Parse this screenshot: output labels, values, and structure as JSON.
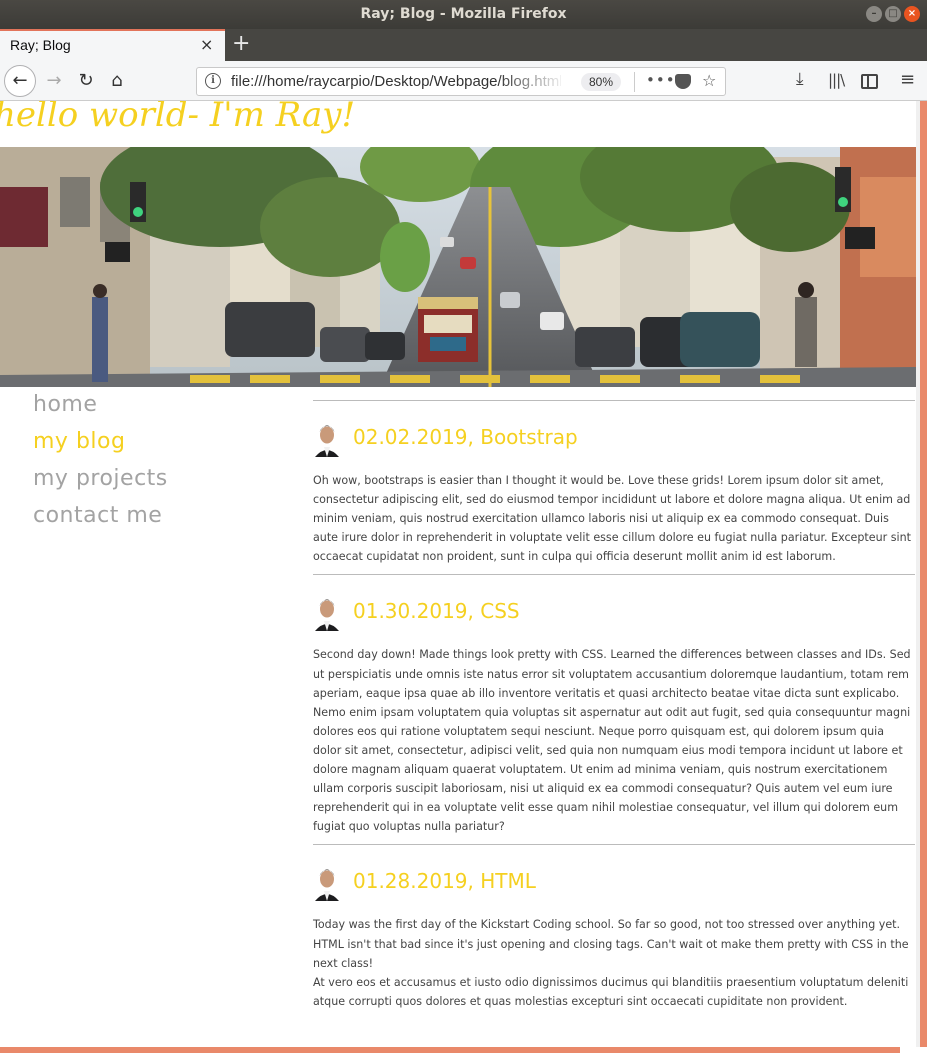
{
  "window": {
    "title": "Ray; Blog - Mozilla Firefox",
    "minimize_glyph": "–",
    "maximize_glyph": "□",
    "close_glyph": "×"
  },
  "tab": {
    "title": "Ray; Blog",
    "close_glyph": "×",
    "newtab_glyph": "+"
  },
  "navbar": {
    "back_glyph": "←",
    "forward_glyph": "→",
    "reload_glyph": "↻",
    "home_glyph": "⌂",
    "url": "file:///home/raycarpio/Desktop/Webpage/blog.html",
    "info_glyph": "i",
    "zoom": "80%",
    "more_glyph": "•••",
    "star_glyph": "☆",
    "download_glyph": "⤓",
    "library_glyph": "|||\\",
    "menu_glyph": "≡"
  },
  "page": {
    "site_title": "hello world- I'm Ray!",
    "nav": [
      {
        "label": "home",
        "active": false
      },
      {
        "label": "my blog",
        "active": true
      },
      {
        "label": "my projects",
        "active": false
      },
      {
        "label": "contact me",
        "active": false
      }
    ],
    "posts": [
      {
        "title": "02.02.2019, Bootstrap",
        "paragraphs": [
          "Oh wow, bootstraps is easier than I thought it would be. Love these grids! Lorem ipsum dolor sit amet, consectetur adipiscing elit, sed do eiusmod tempor incididunt ut labore et dolore magna aliqua. Ut enim ad minim veniam, quis nostrud exercitation ullamco laboris nisi ut aliquip ex ea commodo consequat. Duis aute irure dolor in reprehenderit in voluptate velit esse cillum dolore eu fugiat nulla pariatur. Excepteur sint occaecat cupidatat non proident, sunt in culpa qui officia deserunt mollit anim id est laborum."
        ]
      },
      {
        "title": "01.30.2019, CSS",
        "paragraphs": [
          "Second day down! Made things look pretty with CSS. Learned the differences between classes and IDs. Sed ut perspiciatis unde omnis iste natus error sit voluptatem accusantium doloremque laudantium, totam rem aperiam, eaque ipsa quae ab illo inventore veritatis et quasi architecto beatae vitae dicta sunt explicabo.",
          "Nemo enim ipsam voluptatem quia voluptas sit aspernatur aut odit aut fugit, sed quia consequuntur magni dolores eos qui ratione voluptatem sequi nesciunt. Neque porro quisquam est, qui dolorem ipsum quia dolor sit amet, consectetur, adipisci velit, sed quia non numquam eius modi tempora incidunt ut labore et dolore magnam aliquam quaerat voluptatem. Ut enim ad minima veniam, quis nostrum exercitationem ullam corporis suscipit laboriosam, nisi ut aliquid ex ea commodi consequatur? Quis autem vel eum iure reprehenderit qui in ea voluptate velit esse quam nihil molestiae consequatur, vel illum qui dolorem eum fugiat quo voluptas nulla pariatur?"
        ]
      },
      {
        "title": "01.28.2019, HTML",
        "paragraphs": [
          "Today was the first day of the Kickstart Coding school. So far so good, not too stressed over anything yet. HTML isn't that bad since it's just opening and closing tags. Can't wait ot make them pretty with CSS in the next class!",
          "At vero eos et accusamus et iusto odio dignissimos ducimus qui blanditiis praesentium voluptatum deleniti atque corrupti quos dolores et quas molestias excepturi sint occaecati cupiditate non provident."
        ]
      }
    ]
  },
  "colors": {
    "accent_yellow": "#f5d020",
    "nav_gray": "#a3a3a3",
    "firefox_accent": "#e9896a",
    "titlebar": "#3c3b37"
  }
}
